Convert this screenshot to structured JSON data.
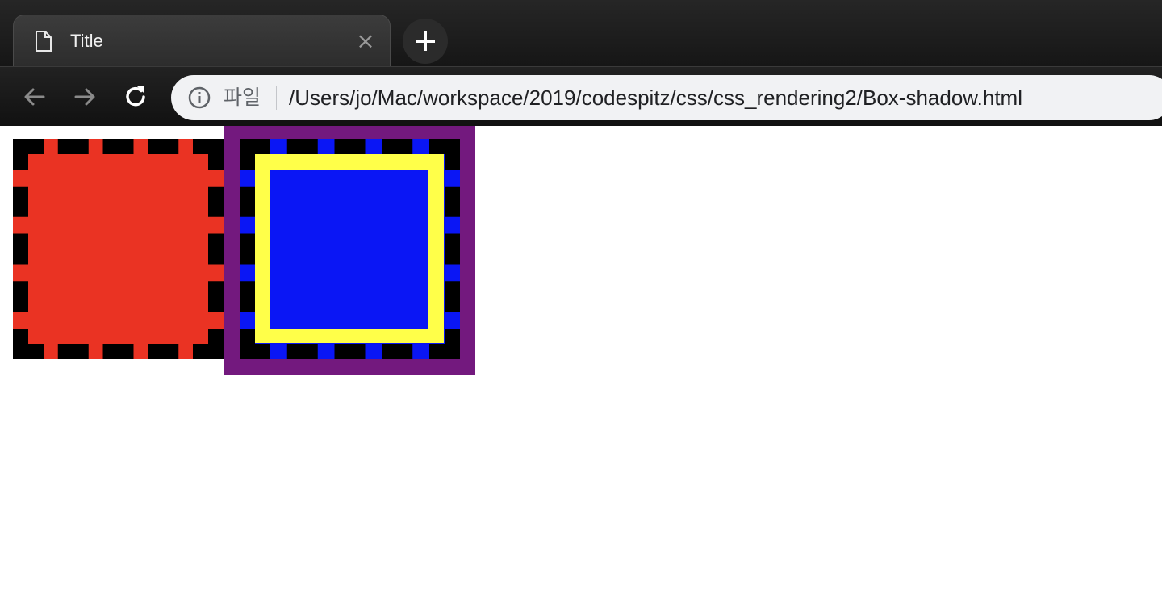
{
  "browser": {
    "tab": {
      "title": "Title",
      "close_symbol": "×"
    },
    "new_tab_icon": "plus-icon",
    "nav": {
      "back_icon": "arrow-left-icon",
      "forward_icon": "arrow-right-icon",
      "reload_icon": "reload-icon"
    },
    "omnibox": {
      "scheme_label": "파일",
      "url": "/Users/jo/Mac/workspace/2019/codespitz/css/css_rendering2/Box-shadow.html"
    }
  },
  "page": {
    "box1": {
      "background": "#ea3323",
      "border_color": "#000000",
      "border_style": "dashed"
    },
    "box2": {
      "shadow_color": "#73197e",
      "border_color": "#000000",
      "border_style": "dashed",
      "inset_shadow_color": "#ffff49",
      "background": "#0a16f5"
    }
  }
}
